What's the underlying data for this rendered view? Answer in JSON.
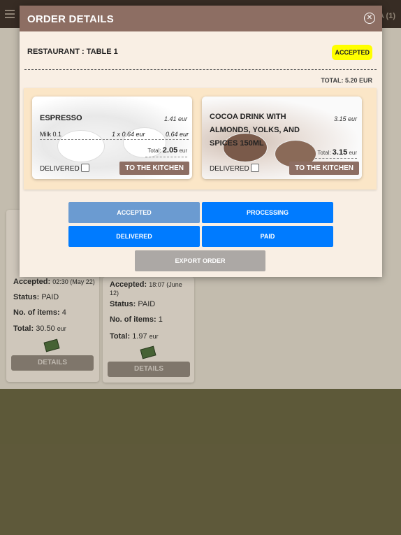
{
  "background": {
    "topbar_right": "A (1)",
    "cards": [
      {
        "accepted_label": "Accepted:",
        "accepted_value": "02:30 (May 22)",
        "status_label": "Status:",
        "status_value": "PAID",
        "items_label": "No. of items:",
        "items_value": "4",
        "total_label": "Total:",
        "total_value": "30.50",
        "total_unit": "eur",
        "button": "DETAILS"
      },
      {
        "accepted_label": "Accepted:",
        "accepted_value": "18:07 (June 12)",
        "status_label": "Status:",
        "status_value": "PAID",
        "items_label": "No. of items:",
        "items_value": "1",
        "total_label": "Total:",
        "total_value": "1.97",
        "total_unit": "eur",
        "button": "DETAILS"
      }
    ]
  },
  "modal": {
    "title": "ORDER DETAILS",
    "restaurant_table": "RESTAURANT : TABLE 1",
    "status_badge": "ACCEPTED",
    "total": "TOTAL: 5.20 EUR",
    "items": [
      {
        "name": "ESPRESSO",
        "price": "1.41 eur",
        "addon_name": "Milk 0.1",
        "addon_qty": "1 x 0.64 eur",
        "addon_price": "0.64 eur",
        "subtotal_label": "Total:",
        "subtotal_value": "2.05",
        "subtotal_unit": "eur",
        "delivered_label": "DELIVERED",
        "kitchen_button": "TO THE KITCHEN"
      },
      {
        "name": "COCOA DRINK WITH ALMONDS, YOLKS, AND SPICES 150ML",
        "price": "3.15 eur",
        "subtotal_label": "Total:",
        "subtotal_value": "3.15",
        "subtotal_unit": "eur",
        "delivered_label": "DELIVERED",
        "kitchen_button": "TO THE KITCHEN"
      }
    ],
    "status_buttons": {
      "accepted": "ACCEPTED",
      "processing": "PROCESSING",
      "delivered": "DELIVERED",
      "paid": "PAID"
    },
    "export_button": "EXPORT ORDER"
  },
  "colors": {
    "header": "#8d6e63",
    "badge": "#ffff00",
    "primary": "#007bff",
    "accepted_faded": "#6b9bd1",
    "export_disabled": "#aca8a5"
  }
}
